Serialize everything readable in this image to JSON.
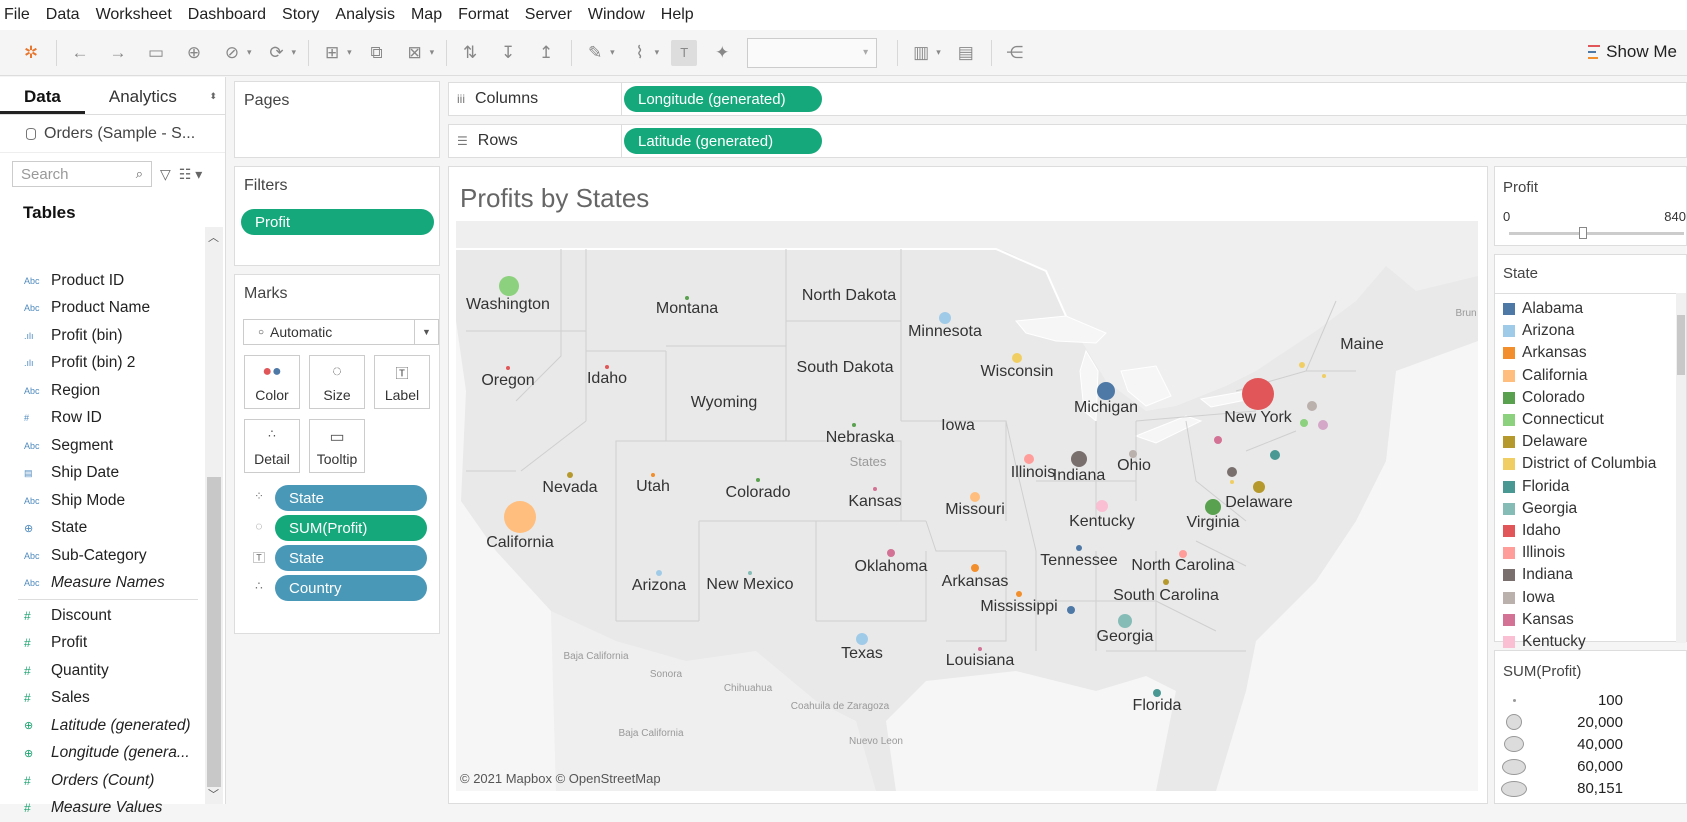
{
  "menu": [
    "File",
    "Data",
    "Worksheet",
    "Dashboard",
    "Story",
    "Analysis",
    "Map",
    "Format",
    "Server",
    "Window",
    "Help"
  ],
  "toolbar": {
    "show_me": "Show Me"
  },
  "left_pane": {
    "tabs": [
      "Data",
      "Analytics"
    ],
    "datasource": "Orders (Sample - S...",
    "search_placeholder": "Search",
    "tables_title": "Tables",
    "dimensions": [
      {
        "type": "Abc",
        "name": "Product ID"
      },
      {
        "type": "Abc",
        "name": "Product Name"
      },
      {
        "type": "bin",
        "name": "Profit (bin)"
      },
      {
        "type": "bin",
        "name": "Profit (bin) 2"
      },
      {
        "type": "Abc",
        "name": "Region"
      },
      {
        "type": "#",
        "name": "Row ID"
      },
      {
        "type": "Abc",
        "name": "Segment"
      },
      {
        "type": "date",
        "name": "Ship Date"
      },
      {
        "type": "Abc",
        "name": "Ship Mode"
      },
      {
        "type": "geo",
        "name": "State"
      },
      {
        "type": "Abc",
        "name": "Sub-Category"
      },
      {
        "type": "Abc",
        "name": "Measure Names",
        "italic": true
      }
    ],
    "measures": [
      {
        "type": "#",
        "name": "Discount"
      },
      {
        "type": "#",
        "name": "Profit"
      },
      {
        "type": "#",
        "name": "Quantity"
      },
      {
        "type": "#",
        "name": "Sales"
      },
      {
        "type": "geo",
        "name": "Latitude (generated)",
        "italic": true
      },
      {
        "type": "geo",
        "name": "Longitude (genera...",
        "italic": true
      },
      {
        "type": "#",
        "name": "Orders (Count)",
        "italic": true
      },
      {
        "type": "#",
        "name": "Measure Values",
        "italic": true
      }
    ]
  },
  "pages": {
    "title": "Pages"
  },
  "filters": {
    "title": "Filters",
    "pills": [
      "Profit"
    ]
  },
  "marks": {
    "title": "Marks",
    "mark_type": "Automatic",
    "buttons": [
      "Color",
      "Size",
      "Label",
      "Detail",
      "Tooltip"
    ],
    "pills": [
      {
        "role": "color",
        "label": "State",
        "kind": "blue"
      },
      {
        "role": "size",
        "label": "SUM(Profit)",
        "kind": "green"
      },
      {
        "role": "label",
        "label": "State",
        "kind": "blue"
      },
      {
        "role": "detail",
        "label": "Country",
        "kind": "blue"
      }
    ]
  },
  "shelves": {
    "columns_label": "Columns",
    "columns_pill": "Longitude (generated)",
    "rows_label": "Rows",
    "rows_pill": "Latitude (generated)"
  },
  "viz": {
    "title": "Profits by States",
    "attribution": "© 2021 Mapbox © OpenStreetMap",
    "state_labels": [
      {
        "name": "Washington"
      },
      {
        "name": "Montana"
      },
      {
        "name": "North Dakota"
      },
      {
        "name": "Minnesota"
      },
      {
        "name": "Oregon"
      },
      {
        "name": "Idaho"
      },
      {
        "name": "South Dakota"
      },
      {
        "name": "Wisconsin"
      },
      {
        "name": "Maine"
      },
      {
        "name": "Wyoming"
      },
      {
        "name": "Michigan"
      },
      {
        "name": "New York"
      },
      {
        "name": "Iowa"
      },
      {
        "name": "Nebraska"
      },
      {
        "name": "Nevada"
      },
      {
        "name": "Utah"
      },
      {
        "name": "Colorado"
      },
      {
        "name": "Illinois"
      },
      {
        "name": "Indiana"
      },
      {
        "name": "Ohio"
      },
      {
        "name": "Kansas"
      },
      {
        "name": "Missouri"
      },
      {
        "name": "Delaware"
      },
      {
        "name": "California"
      },
      {
        "name": "Kentucky"
      },
      {
        "name": "Virginia"
      },
      {
        "name": "Tennessee"
      },
      {
        "name": "North Carolina"
      },
      {
        "name": "Oklahoma"
      },
      {
        "name": "Arizona"
      },
      {
        "name": "New Mexico"
      },
      {
        "name": "Arkansas"
      },
      {
        "name": "South Carolina"
      },
      {
        "name": "Mississippi"
      },
      {
        "name": "Texas"
      },
      {
        "name": "Georgia"
      },
      {
        "name": "Louisiana"
      },
      {
        "name": "Florida"
      }
    ],
    "base_labels": [
      "States",
      "Baja California",
      "Sonora",
      "Chihuahua",
      "Coahuila de Zaragoza",
      "Nuevo Leon",
      "Baja California",
      "Brun"
    ]
  },
  "profit_filter": {
    "title": "Profit",
    "min": "0",
    "max": "840"
  },
  "state_legend": {
    "title": "State",
    "items": [
      {
        "name": "Alabama",
        "color": "#4e79a7"
      },
      {
        "name": "Arizona",
        "color": "#a0cbe8"
      },
      {
        "name": "Arkansas",
        "color": "#f28e2b"
      },
      {
        "name": "California",
        "color": "#ffbe7d"
      },
      {
        "name": "Colorado",
        "color": "#59a14f"
      },
      {
        "name": "Connecticut",
        "color": "#8cd17d"
      },
      {
        "name": "Delaware",
        "color": "#b6992d"
      },
      {
        "name": "District of Columbia",
        "color": "#f1ce63"
      },
      {
        "name": "Florida",
        "color": "#499894"
      },
      {
        "name": "Georgia",
        "color": "#86bcb6"
      },
      {
        "name": "Idaho",
        "color": "#e15759"
      },
      {
        "name": "Illinois",
        "color": "#ff9d9a"
      },
      {
        "name": "Indiana",
        "color": "#79706e"
      },
      {
        "name": "Iowa",
        "color": "#bab0ac"
      },
      {
        "name": "Kansas",
        "color": "#d37295"
      },
      {
        "name": "Kentucky",
        "color": "#fabfd2"
      }
    ]
  },
  "size_legend": {
    "title": "SUM(Profit)",
    "items": [
      "100",
      "20,000",
      "40,000",
      "60,000",
      "80,151"
    ]
  }
}
